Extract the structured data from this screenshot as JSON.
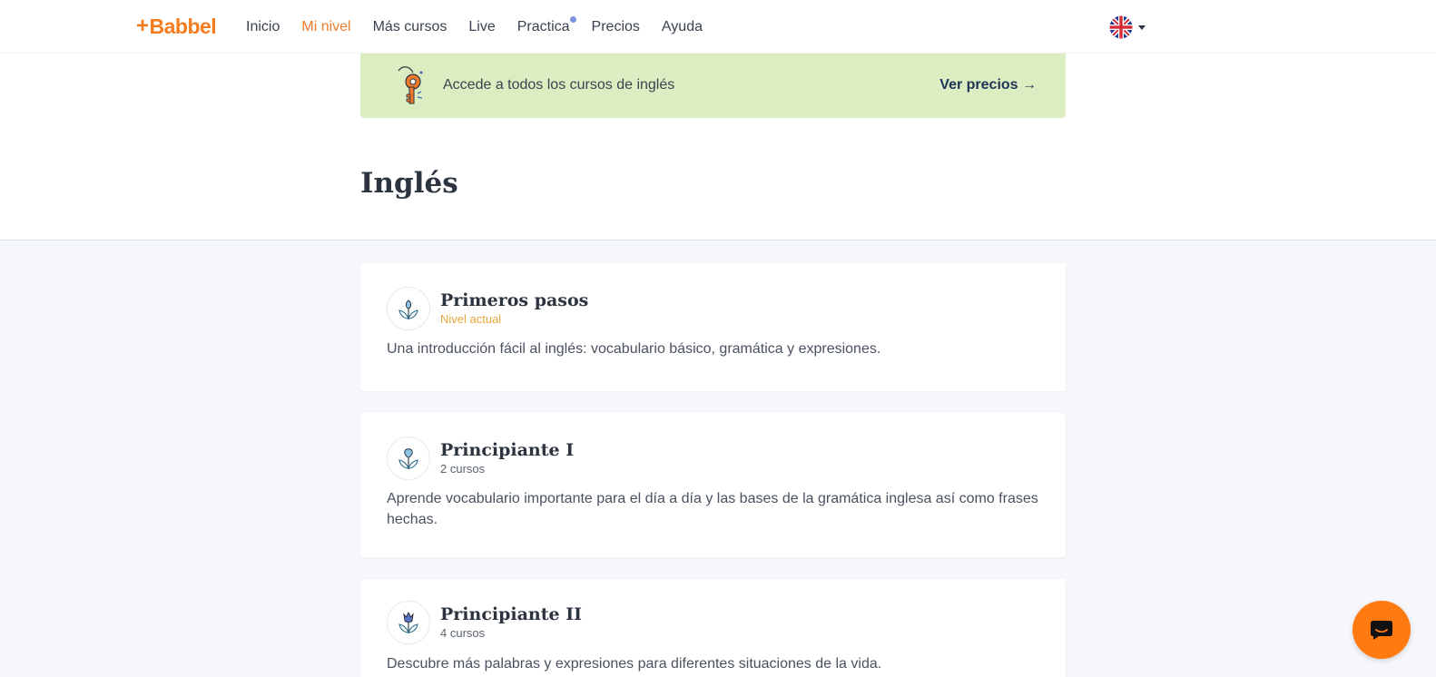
{
  "brand": {
    "name": "Babbel",
    "plus": "+"
  },
  "nav": {
    "items": [
      "Inicio",
      "Mi nivel",
      "Más cursos",
      "Live",
      "Practica",
      "Precios",
      "Ayuda"
    ],
    "active": "Mi nivel"
  },
  "language": {
    "icon": "uk-flag-icon"
  },
  "promo": {
    "text": "Accede a todos los cursos de inglés",
    "link": "Ver precios →",
    "background": "#dcedc1"
  },
  "page": {
    "title": "Inglés"
  },
  "levels": [
    {
      "title": "Primeros pasos",
      "subtitle": "Nivel actual",
      "description": "Una introducción fácil al inglés: vocabulario básico, gramática y expresiones."
    },
    {
      "title": "Principiante I",
      "subtitle": "2 cursos",
      "description": "Aprende vocabulario importante para el día a día y las bases de la gramática inglesa así como frases hechas."
    },
    {
      "title": "Principiante II",
      "subtitle": "4 cursos",
      "description": "Descubre más palabras y expresiones para diferentes situaciones de la vida."
    }
  ],
  "colors": {
    "accent": "#f57c1f",
    "current_level": "#e8a63c",
    "chat": "#ff7b12"
  }
}
